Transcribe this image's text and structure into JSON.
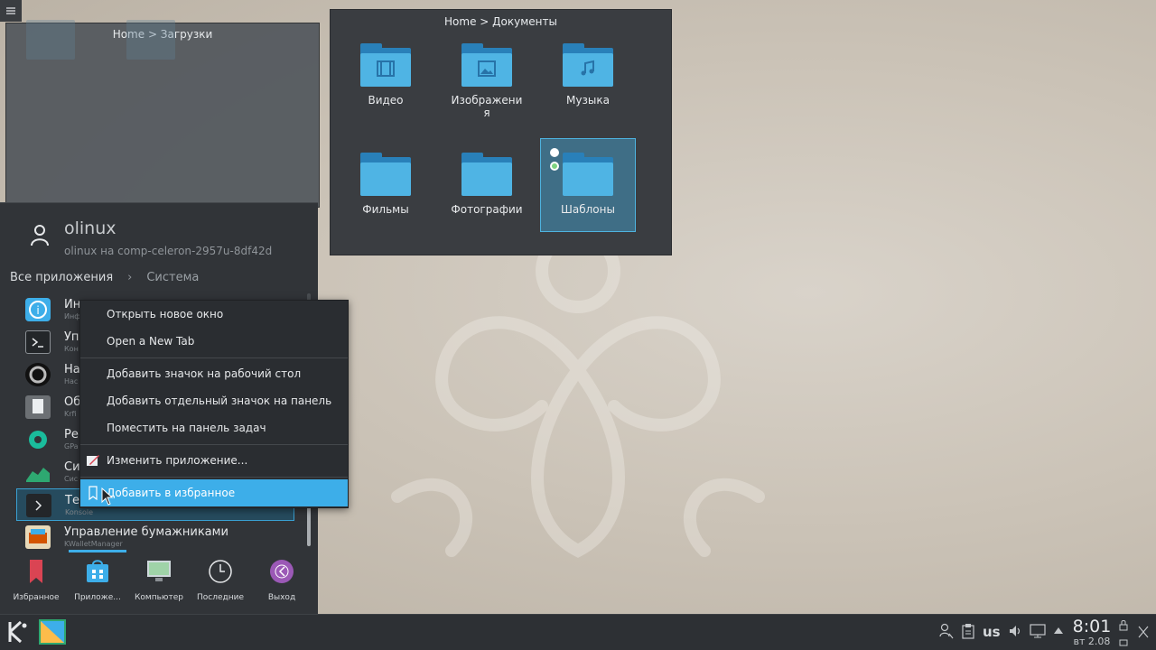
{
  "left_view": {
    "breadcrumb": "Home > Загрузки"
  },
  "right_view": {
    "breadcrumb": "Home > Документы",
    "folders": [
      {
        "label": "Видео",
        "icon": "video-icon"
      },
      {
        "label": "Изображени\nя",
        "icon": "image-icon"
      },
      {
        "label": "Музыка",
        "icon": "music-icon"
      },
      {
        "label": "Фильмы",
        "icon": "folder-icon"
      },
      {
        "label": "Фотографии",
        "icon": "folder-icon"
      },
      {
        "label": "Шаблоны",
        "icon": "folder-icon",
        "selected": true
      }
    ]
  },
  "launcher": {
    "user_name": "olinux",
    "user_host": "olinux на comp-celeron-2957u-8df42d",
    "breadcrumb_root": "Все приложения",
    "breadcrumb_current": "Система",
    "apps": [
      {
        "name": "Ин",
        "sub": "Инф",
        "icon": "info-icon",
        "color": "#3daee9"
      },
      {
        "name": "Уп",
        "sub": "Кон",
        "icon": "terminal-icon",
        "color": "#232629"
      },
      {
        "name": "На",
        "sub": "Нас",
        "icon": "settings-icon",
        "color": "#111"
      },
      {
        "name": "Об",
        "sub": "Krfi",
        "icon": "document-icon",
        "color": "#6c7074"
      },
      {
        "name": "Ре",
        "sub": "GPa",
        "icon": "partition-icon",
        "color": "#1abc9c"
      },
      {
        "name": "Си",
        "sub": "Сис",
        "icon": "monitor-icon",
        "color": "#2ea871"
      },
      {
        "name": "Те",
        "sub": "Konsole",
        "icon": "konsole-icon",
        "color": "#232629",
        "highlight": true
      },
      {
        "name": "Управление бумажниками",
        "sub": "KWalletManager",
        "icon": "wallet-icon",
        "color": "#e8d9b8"
      }
    ],
    "tabs": [
      {
        "label": "Избранное",
        "icon": "bookmark-icon",
        "color": "#da4453"
      },
      {
        "label": "Приложе...",
        "icon": "applications-icon",
        "color": "#3daee9"
      },
      {
        "label": "Компьютер",
        "icon": "computer-icon",
        "color": "#9fd3a8"
      },
      {
        "label": "Последние",
        "icon": "clock-icon",
        "color": "#2d3034"
      },
      {
        "label": "Выход",
        "icon": "leave-icon",
        "color": "#9b59b6"
      }
    ]
  },
  "context_menu": {
    "items": [
      {
        "label": "Открыть новое окно"
      },
      {
        "label": "Open a New Tab"
      },
      {
        "label": "Добавить значок на рабочий стол"
      },
      {
        "label": "Добавить отдельный значок на панель"
      },
      {
        "label": "Поместить на панель задач"
      },
      {
        "label": "Изменить приложение...",
        "icon": "edit-icon"
      },
      {
        "label": "Добавить в избранное",
        "icon": "bookmark-icon",
        "active": true
      }
    ]
  },
  "taskbar": {
    "keyboard_layout": "us",
    "time": "8:01",
    "date": "вт 2.08"
  }
}
